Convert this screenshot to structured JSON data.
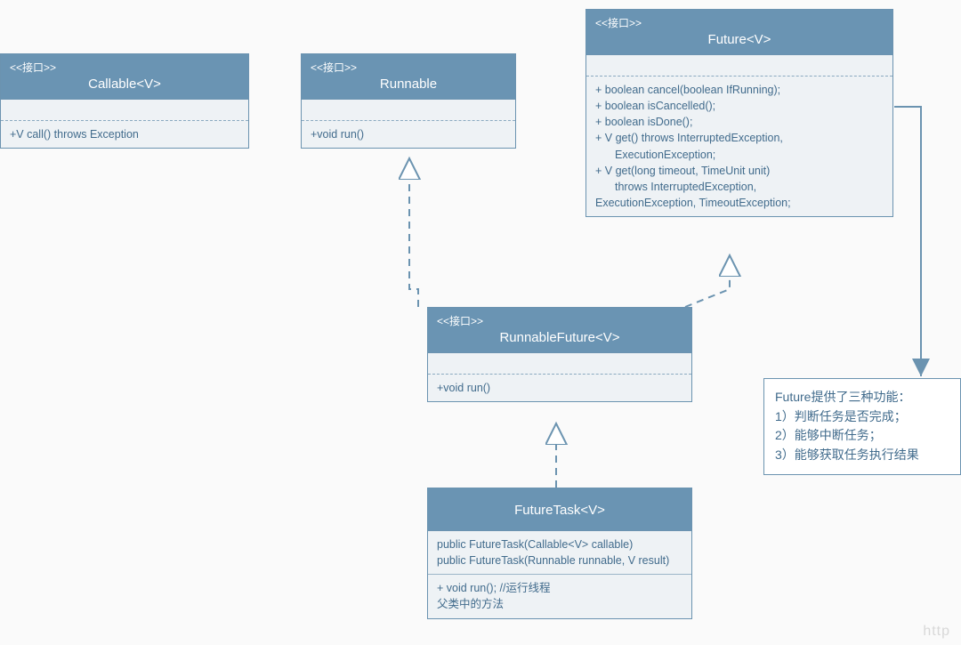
{
  "callable": {
    "stereotype": "<<接口>>",
    "name": "Callable<V>",
    "methods": "+V call() throws Exception"
  },
  "runnable": {
    "stereotype": "<<接口>>",
    "name": "Runnable",
    "methods": "+void run()"
  },
  "future": {
    "stereotype": "<<接口>>",
    "name": "Future<V>",
    "m1": "+ boolean cancel(boolean IfRunning);",
    "m2": "+ boolean isCancelled();",
    "m3": "+ boolean isDone();",
    "m4": "+ V get() throws InterruptedException,",
    "m4b": "ExecutionException;",
    "m5": "+ V get(long timeout, TimeUnit unit)",
    "m5b": "throws InterruptedException,",
    "m5c": "ExecutionException, TimeoutException;"
  },
  "runnableFuture": {
    "stereotype": "<<接口>>",
    "name": "RunnableFuture<V>",
    "methods": "+void run()"
  },
  "futureTask": {
    "name": "FutureTask<V>",
    "c1": "public FutureTask(Callable<V> callable)",
    "c2": "public FutureTask(Runnable runnable, V result)",
    "m1": "+ void run(); //运行线程",
    "m2": "父类中的方法"
  },
  "note": {
    "title": "Future提供了三种功能：",
    "l1": "1）判断任务是否完成；",
    "l2": "2）能够中断任务；",
    "l3": "3）能够获取任务执行结果"
  },
  "watermark": "http"
}
